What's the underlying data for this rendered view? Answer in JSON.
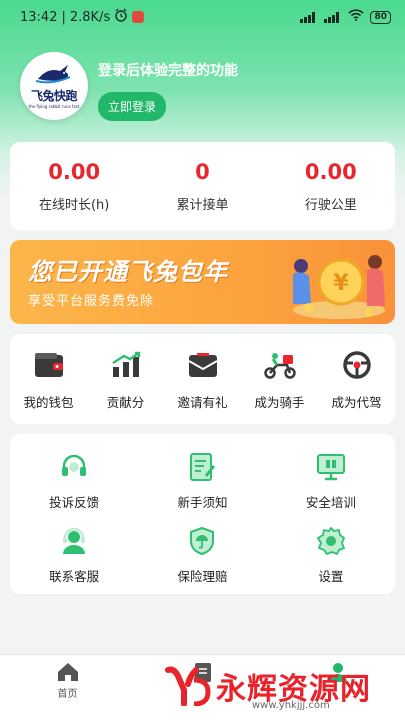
{
  "status_bar": {
    "time": "13:42",
    "network_speed": "2.8K/s",
    "separator": "|",
    "battery": "80"
  },
  "profile": {
    "logo_text": "飞兔快跑",
    "logo_subtext": "the flying rabbit runs fast",
    "login_hint": "登录后体验完整的功能",
    "login_button": "立即登录"
  },
  "stats": [
    {
      "value": "0.00",
      "label": "在线时长(h)"
    },
    {
      "value": "0",
      "label": "累计接单"
    },
    {
      "value": "0.00",
      "label": "行驶公里"
    }
  ],
  "banner": {
    "title": "您已开通飞兔包年",
    "subtitle": "享受平台服务费免除"
  },
  "features": [
    {
      "label": "我的钱包",
      "icon": "wallet-icon"
    },
    {
      "label": "贡献分",
      "icon": "bar-chart-icon"
    },
    {
      "label": "邀请有礼",
      "icon": "envelope-icon"
    },
    {
      "label": "成为骑手",
      "icon": "scooter-icon"
    },
    {
      "label": "成为代驾",
      "icon": "steering-wheel-icon"
    }
  ],
  "services": [
    {
      "label": "投诉反馈",
      "icon": "headset-icon"
    },
    {
      "label": "新手须知",
      "icon": "notebook-icon"
    },
    {
      "label": "安全培训",
      "icon": "monitor-icon"
    },
    {
      "label": "联系客服",
      "icon": "support-agent-icon"
    },
    {
      "label": "保险理赔",
      "icon": "umbrella-shield-icon"
    },
    {
      "label": "设置",
      "icon": "gear-icon"
    }
  ],
  "tabbar": [
    {
      "label": "首页",
      "icon": "home-icon"
    },
    {
      "label": "",
      "icon": "orders-icon"
    },
    {
      "label": "",
      "icon": "profile-icon"
    }
  ],
  "watermark": {
    "text": "永辉资源网",
    "url": "www.yhkjjj.com"
  },
  "colors": {
    "brand_green": "#21b86a",
    "stat_red": "#e8262d",
    "banner_orange": "#fca33e",
    "icon_dark": "#3a3a3a",
    "icon_green": "#2fbf71"
  }
}
